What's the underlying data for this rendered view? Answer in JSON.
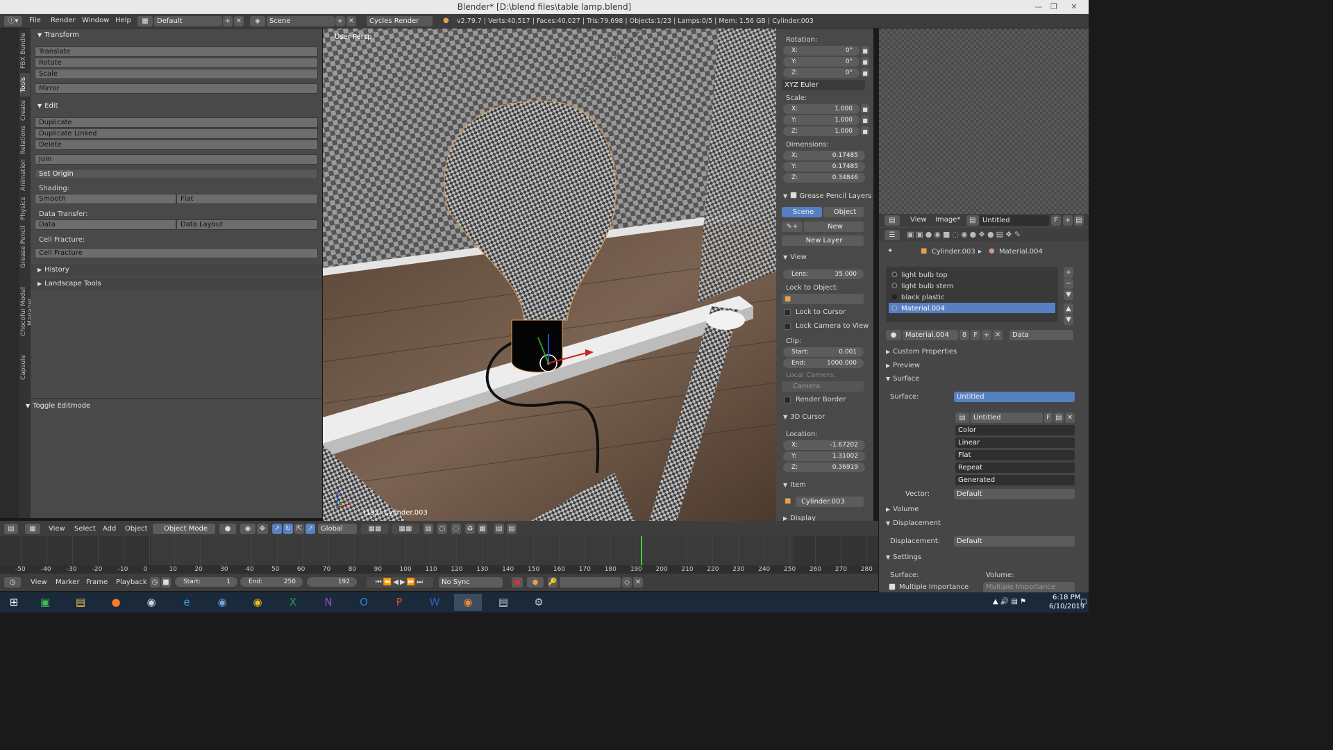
{
  "window": {
    "title": "Blender* [D:\\blend files\\table lamp.blend]"
  },
  "topbar": {
    "menus": [
      "File",
      "Render",
      "Window",
      "Help"
    ],
    "screen": "Default",
    "scene": "Scene",
    "engine": "Cycles Render",
    "stats": "v2.79.7 | Verts:40,517 | Faces:40,027 | Tris:79,698 | Objects:1/23 | Lamps:0/5 | Mem: 1.56 GB | Cylinder.003"
  },
  "lefttabs": [
    "FBX Bundle",
    "Tools",
    "Create",
    "Relations",
    "Animation",
    "Physics",
    "Grease Pencil",
    "Chocofur Model Manager",
    "Capsule"
  ],
  "toolshelf": {
    "transform": {
      "title": "Transform",
      "buttons": [
        "Translate",
        "Rotate",
        "Scale",
        "Mirror"
      ]
    },
    "edit": {
      "title": "Edit",
      "buttons": [
        "Duplicate",
        "Duplicate Linked",
        "Delete",
        "Join"
      ],
      "set_origin": "Set Origin"
    },
    "shading": {
      "label": "Shading:",
      "smooth": "Smooth",
      "flat": "Flat"
    },
    "data_transfer": {
      "label": "Data Transfer:",
      "data": "Data",
      "data_layout": "Data Layout"
    },
    "cell_fracture": {
      "label": "Cell Fracture:",
      "button": "Cell Fracture"
    },
    "history": "History",
    "landscape": "Landscape Tools",
    "toggle_editmode": "Toggle Editmode"
  },
  "viewport": {
    "view_label": "User Persp",
    "object_label": "(192) Cylinder.003"
  },
  "props": {
    "rotation_label": "Rotation:",
    "rotation": [
      {
        "k": "X:",
        "v": "0°"
      },
      {
        "k": "Y:",
        "v": "0°"
      },
      {
        "k": "Z:",
        "v": "0°"
      }
    ],
    "rotation_mode": "XYZ Euler",
    "scale_label": "Scale:",
    "scale": [
      {
        "k": "X:",
        "v": "1.000"
      },
      {
        "k": "Y:",
        "v": "1.000"
      },
      {
        "k": "Z:",
        "v": "1.000"
      }
    ],
    "dimensions_label": "Dimensions:",
    "dimensions": [
      {
        "k": "X:",
        "v": "0.17485"
      },
      {
        "k": "Y:",
        "v": "0.17485"
      },
      {
        "k": "Z:",
        "v": "0.34846"
      }
    ],
    "grease_title": "Grease Pencil Layers",
    "scene_tab": "Scene",
    "object_tab": "Object",
    "new": "New",
    "new_layer": "New Layer",
    "view_title": "View",
    "lens_k": "Lens:",
    "lens_v": "35.000",
    "lock_object": "Lock to Object:",
    "lock_cursor": "Lock to Cursor",
    "lock_camera": "Lock Camera to View",
    "clip_label": "Clip:",
    "clip_start_k": "Start:",
    "clip_start_v": "0.001",
    "clip_end_k": "End:",
    "clip_end_v": "1000.000",
    "local_camera": "Local Camera:",
    "camera": "Camera",
    "render_border": "Render Border",
    "cursor_title": "3D Cursor",
    "location_label": "Location:",
    "location": [
      {
        "k": "X:",
        "v": "-1.67202"
      },
      {
        "k": "Y:",
        "v": "1.31002"
      },
      {
        "k": "Z:",
        "v": "0.36919"
      }
    ],
    "item_title": "Item",
    "item_name": "Cylinder.003",
    "display_title": "Display"
  },
  "imageeditor": {
    "view": "View",
    "image": "Image*",
    "image_name": "Untitled",
    "f": "F"
  },
  "material": {
    "breadcrumb_obj": "Cylinder.003",
    "breadcrumb_mat": "Material.004",
    "slots": [
      "light bulb top",
      "light bulb stem",
      "black plastic",
      "Material.004"
    ],
    "mat_name": "Material.004",
    "users": "8",
    "f": "F",
    "link": "Data",
    "custom": "Custom Properties",
    "preview": "Preview",
    "surface_title": "Surface",
    "surface_label": "Surface:",
    "surface_val": "Untitled",
    "tex_name": "Untitled",
    "tex_opts": [
      "Color",
      "Linear",
      "Flat",
      "Repeat",
      "Generated"
    ],
    "vector_label": "Vector:",
    "vector_val": "Default",
    "volume": "Volume",
    "displacement": "Displacement",
    "disp_label": "Displacement:",
    "disp_val": "Default",
    "settings": "Settings",
    "settings_surface": "Surface:",
    "settings_volume": "Volume:",
    "mis": "Multiple Importance",
    "mis2": "Multiple Importance"
  },
  "vpheader": {
    "view": "View",
    "select": "Select",
    "add": "Add",
    "object": "Object",
    "mode": "Object Mode",
    "orient": "Global"
  },
  "timeline": {
    "ticks": [
      "-50",
      "-40",
      "-30",
      "-20",
      "-10",
      "0",
      "10",
      "20",
      "30",
      "40",
      "50",
      "60",
      "70",
      "80",
      "90",
      "100",
      "110",
      "120",
      "130",
      "140",
      "150",
      "160",
      "170",
      "180",
      "190",
      "200",
      "210",
      "220",
      "230",
      "240",
      "250",
      "260",
      "270",
      "280"
    ],
    "current_frame": 192
  },
  "tlheader": {
    "view": "View",
    "marker": "Marker",
    "frame": "Frame",
    "playback": "Playback",
    "start_k": "Start:",
    "start_v": "1",
    "end_k": "End:",
    "end_v": "250",
    "current": "192",
    "sync": "No Sync"
  },
  "taskbar": {
    "time": "6:18 PM",
    "date": "6/10/2019"
  },
  "colors": {
    "accent": "#5680c2",
    "header": "#3d3d3d",
    "panel": "#494949"
  }
}
